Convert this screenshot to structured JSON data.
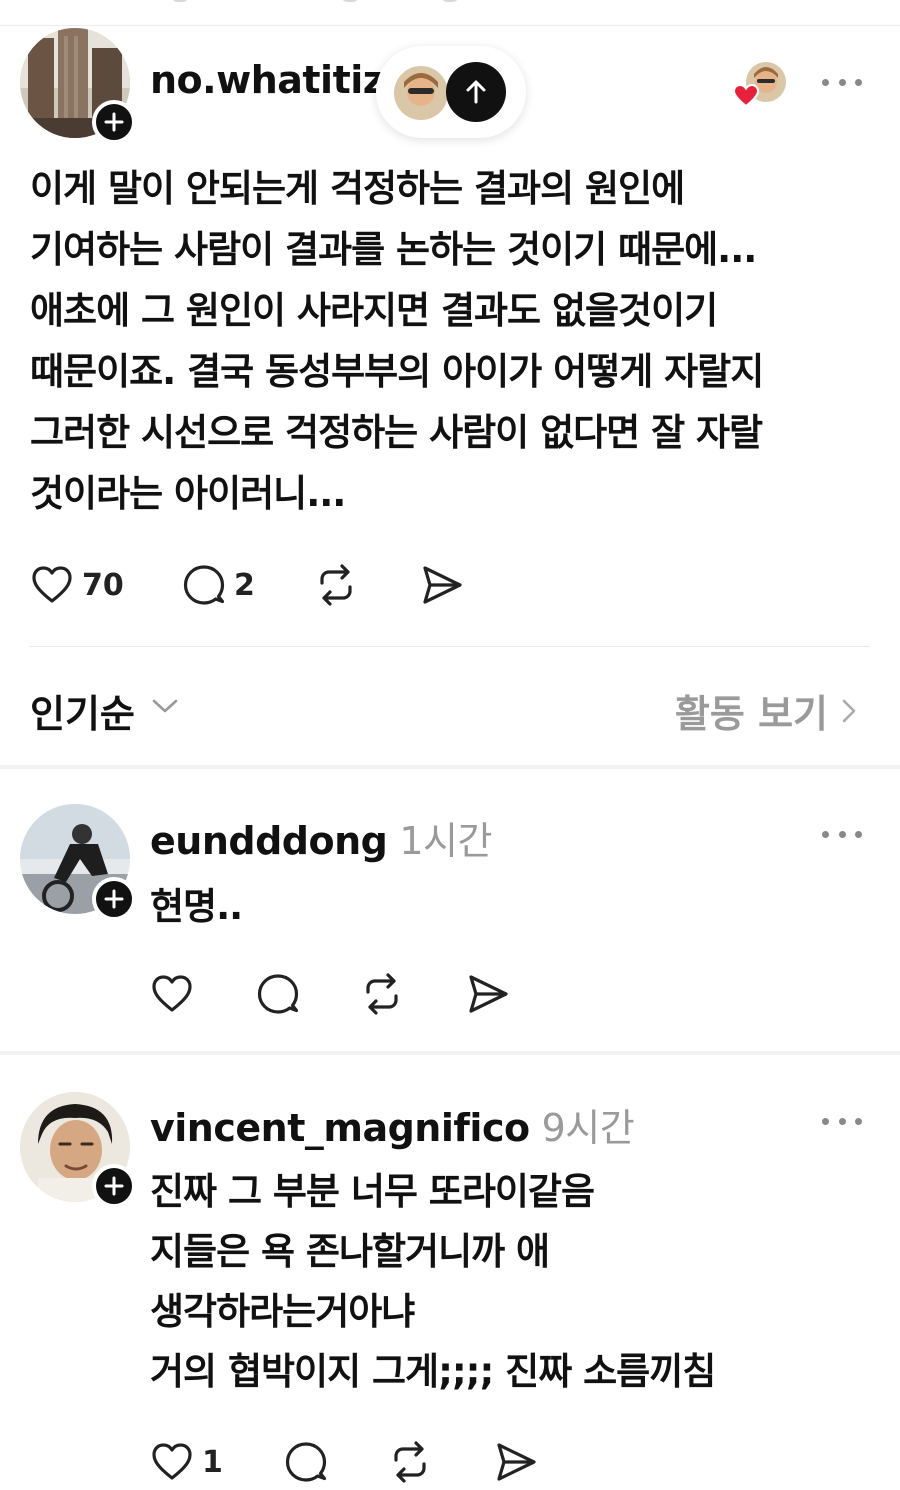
{
  "post": {
    "username": "no.whatitiz",
    "text_lines": [
      "이게 말이 안되는게 걱정하는 결과의 원인에",
      "기여하는 사람이 결과를 논하는 것이기 때문에...",
      "애초에 그 원인이 사라지면 결과도 없을것이기",
      "때문이죠. 결국 동성부부의 아이가 어떻게 자랄지",
      "그러한 시선으로 걱정하는 사람이 없다면 잘 자랄",
      "것이라는 아이러니..."
    ],
    "like_count": "70",
    "comment_count": "2"
  },
  "sort": {
    "label": "인기순",
    "activity_label": "활동 보기"
  },
  "replies": [
    {
      "username": "eundddong",
      "time": "1시간",
      "text_lines": [
        "현명.."
      ],
      "like_count": ""
    },
    {
      "username": "vincent_magnifico",
      "time": "9시간",
      "text_lines": [
        "진짜 그 부분 너무 또라이같음",
        "지들은 욕 존나할거니까 애",
        "생각하라는거아냐",
        "거의 협박이지 그게;;;; 진짜 소름끼침"
      ],
      "like_count": "1"
    }
  ],
  "icons": {
    "like": "heart-icon",
    "comment": "comment-icon",
    "repost": "repost-icon",
    "share": "send-icon",
    "follow": "plus-icon",
    "more": "more-dots-icon",
    "up": "arrow-up-icon"
  },
  "colors": {
    "text": "#111111",
    "muted": "#9a9a9a",
    "heart_badge": "#e8213b",
    "divider": "#e6e6e6"
  }
}
